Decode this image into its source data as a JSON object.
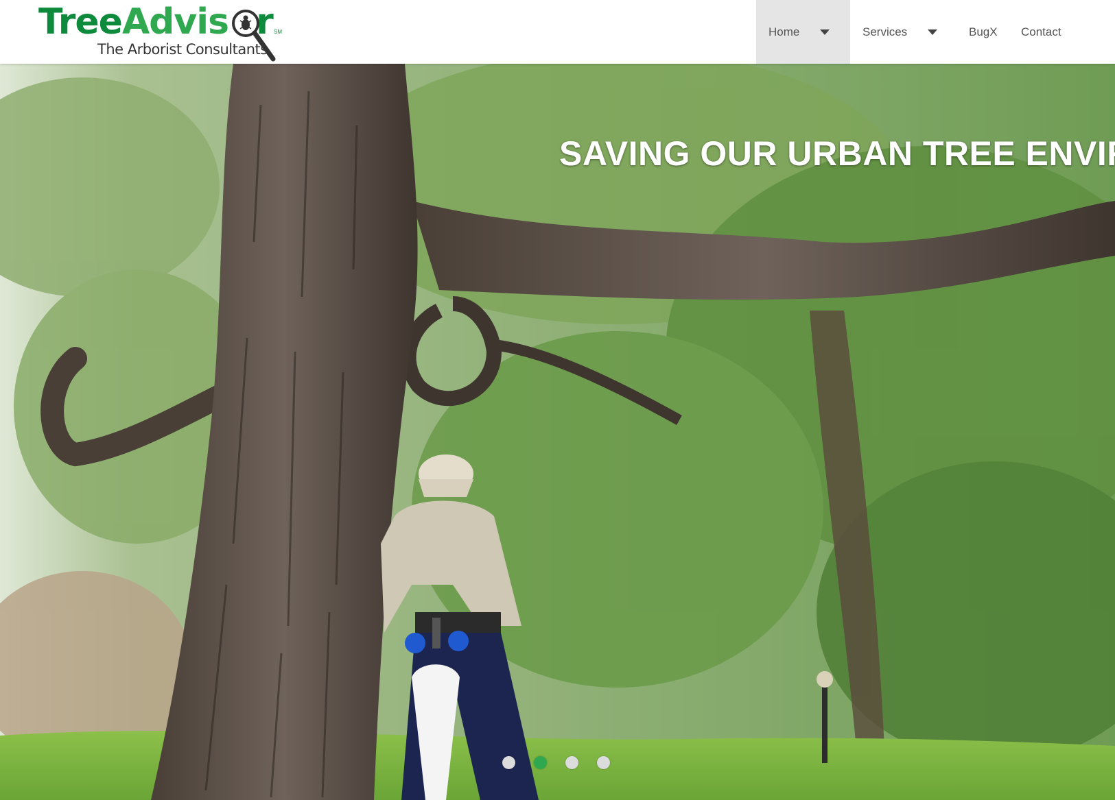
{
  "header": {
    "logo": {
      "word_part1": "Tree",
      "word_part2": "Advis",
      "word_part3": "r",
      "service_mark": "SM",
      "tagline": "The Arborist Consultants"
    },
    "nav": {
      "home": "Home",
      "services": "Services",
      "bugx": "BugX",
      "contact": "Contact"
    }
  },
  "hero": {
    "headline": "SAVING OUR URBAN TREE ENVIRO",
    "slider": {
      "slide_count": 4,
      "active_index": 1
    }
  },
  "colors": {
    "brand_dark_green": "#0e8a3c",
    "brand_green": "#2fa84f",
    "nav_active_bg": "#e5e5e5",
    "dot_active": "#2fa84f",
    "dot_inactive": "#dcdcdc"
  },
  "icons": [
    "magnifier-bug-icon",
    "caret-down-icon"
  ]
}
